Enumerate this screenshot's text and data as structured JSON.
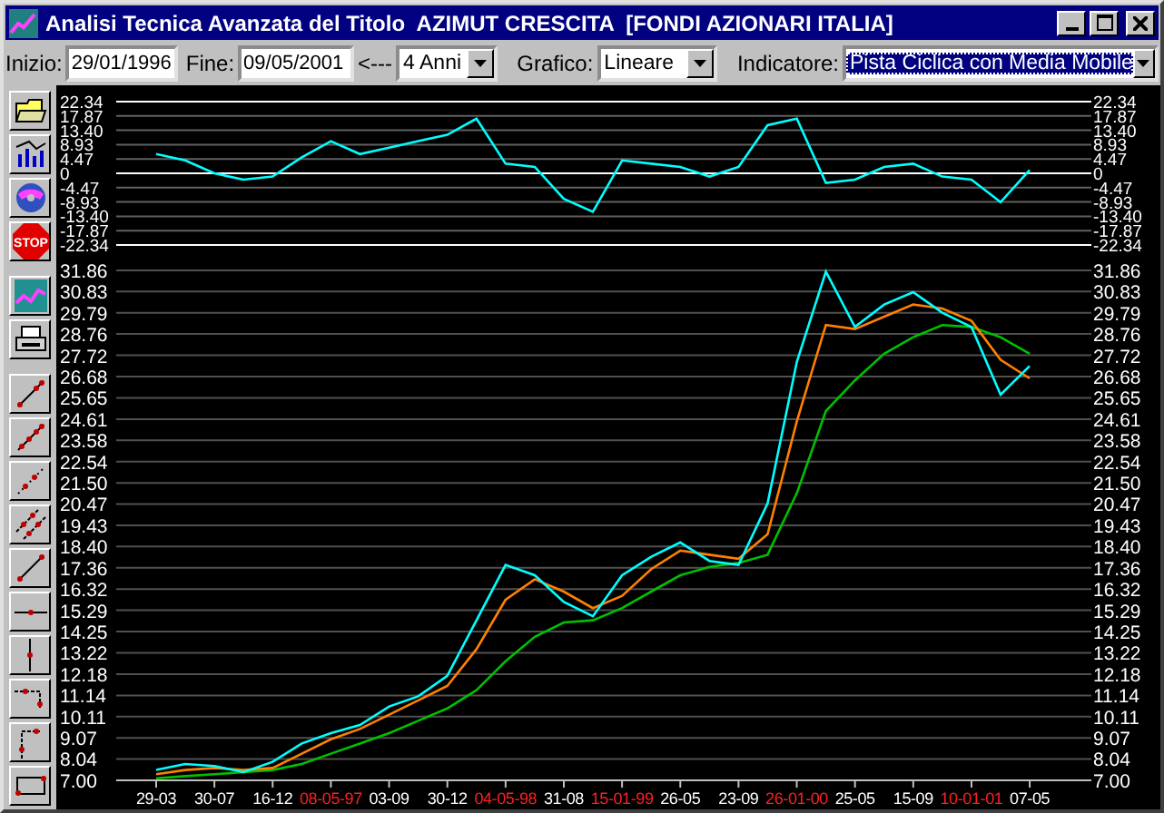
{
  "window": {
    "title": "Analisi Tecnica Avanzata del Titolo  AZIMUT CRESCITA  [FONDI AZIONARI ITALIA]"
  },
  "toolbar": {
    "start_label": "Inizio:",
    "start_value": "29/01/1996",
    "end_label": "Fine:",
    "end_value": "09/05/2001",
    "arrow": "<---",
    "period": "4 Anni",
    "chart_label": "Grafico:",
    "chart_type": "Lineare",
    "indicator_label": "Indicatore:",
    "indicator": "Pista Ciclica con Media Mobile"
  },
  "tools": [
    {
      "kind": "folder"
    },
    {
      "kind": "bars"
    },
    {
      "kind": "disc"
    },
    {
      "kind": "stop",
      "label": "STOP"
    },
    {
      "kind": "chart"
    },
    {
      "kind": "printer"
    },
    {
      "kind": "trend"
    },
    {
      "kind": "trend4"
    },
    {
      "kind": "dotted"
    },
    {
      "kind": "parallel"
    },
    {
      "kind": "line"
    },
    {
      "kind": "horizontal"
    },
    {
      "kind": "vertical"
    },
    {
      "kind": "hcorner"
    },
    {
      "kind": "vcorner"
    },
    {
      "kind": "rectangle"
    }
  ],
  "oscillator": {
    "right_labels": [
      "22.34",
      "17.87",
      "13.40",
      "8.93",
      "4.47",
      "0",
      "-4.47",
      "-8.93",
      "-13.40",
      "-17.87",
      "-22.34"
    ],
    "chart_data": {
      "type": "line",
      "grid": true,
      "ylim": [
        -22.34,
        22.34
      ],
      "yticks": [
        {
          "value": 22.34,
          "label": "22.34"
        },
        {
          "value": 17.87,
          "label": "17.87"
        },
        {
          "value": 13.4,
          "label": "13.40"
        },
        {
          "value": 8.93,
          "label": "8.93"
        },
        {
          "value": 4.47,
          "label": "4.47"
        },
        {
          "value": 0,
          "label": "0"
        },
        {
          "value": -4.47,
          "label": "-4.47"
        },
        {
          "value": -8.93,
          "label": "-8.93"
        },
        {
          "value": -13.4,
          "label": "-13.40"
        },
        {
          "value": -17.87,
          "label": "-17.87"
        },
        {
          "value": -22.34,
          "label": "-22.34"
        }
      ],
      "series": [
        {
          "color": "#00ffff",
          "values": [
            6,
            4,
            0,
            -2,
            -1,
            5,
            10,
            6,
            8,
            10,
            12,
            17,
            3,
            2,
            -8,
            -12,
            4,
            3,
            2,
            -1,
            2,
            15,
            17,
            -3,
            -2,
            2,
            3,
            -1,
            -2,
            -9,
            1
          ]
        }
      ]
    }
  },
  "price": {
    "right_labels": [
      "31.86",
      "30.83",
      "29.79",
      "28.76",
      "27.72",
      "26.68",
      "25.65",
      "24.61",
      "23.58",
      "22.54",
      "21.50",
      "20.47",
      "19.43",
      "18.40",
      "17.36",
      "16.32",
      "15.29",
      "14.25",
      "13.22",
      "12.18",
      "11.14",
      "10.11",
      "9.07",
      "8.04",
      "7.00"
    ],
    "xtick_highlighted": [
      false,
      false,
      false,
      true,
      false,
      false,
      true,
      false,
      true,
      false,
      false,
      true,
      false,
      false,
      true,
      false
    ],
    "chart_data": {
      "type": "line",
      "grid": true,
      "ylim": [
        7,
        31.86
      ],
      "categories": [
        "29-03",
        null,
        "30-07",
        null,
        "16-12",
        null,
        "08-05-97",
        null,
        "03-09",
        null,
        "30-12",
        null,
        "04-05-98",
        null,
        "31-08",
        null,
        "15-01-99",
        null,
        "26-05",
        null,
        "23-09",
        null,
        "26-01-00",
        null,
        "25-05",
        null,
        "15-09",
        null,
        "10-01-01",
        null,
        "07-05"
      ],
      "yticks": [
        {
          "value": 31.86,
          "label": "31.86"
        },
        {
          "value": 30.83,
          "label": "30.83"
        },
        {
          "value": 29.79,
          "label": "29.79"
        },
        {
          "value": 28.76,
          "label": "28.76"
        },
        {
          "value": 27.72,
          "label": "27.72"
        },
        {
          "value": 26.68,
          "label": "26.68"
        },
        {
          "value": 25.65,
          "label": "25.65"
        },
        {
          "value": 24.61,
          "label": "24.61"
        },
        {
          "value": 23.58,
          "label": "23.58"
        },
        {
          "value": 22.54,
          "label": "22.54"
        },
        {
          "value": 21.5,
          "label": "21.50"
        },
        {
          "value": 20.47,
          "label": "20.47"
        },
        {
          "value": 19.43,
          "label": "19.43"
        },
        {
          "value": 18.4,
          "label": "18.40"
        },
        {
          "value": 17.36,
          "label": "17.36"
        },
        {
          "value": 16.32,
          "label": "16.32"
        },
        {
          "value": 15.29,
          "label": "15.29"
        },
        {
          "value": 14.25,
          "label": "14.25"
        },
        {
          "value": 13.22,
          "label": "13.22"
        },
        {
          "value": 12.18,
          "label": "12.18"
        },
        {
          "value": 11.14,
          "label": "11.14"
        },
        {
          "value": 10.11,
          "label": "10.11"
        },
        {
          "value": 9.07,
          "label": "9.07"
        },
        {
          "value": 8.04,
          "label": "8.04"
        },
        {
          "value": 7,
          "label": "7.00"
        }
      ],
      "series": [
        {
          "color": "#00c000",
          "values": [
            7.1,
            7.2,
            7.3,
            7.4,
            7.5,
            7.8,
            8.3,
            8.8,
            9.3,
            9.9,
            10.5,
            11.4,
            12.8,
            14.0,
            14.7,
            14.8,
            15.4,
            16.2,
            17.0,
            17.4,
            17.6,
            18.0,
            21.0,
            25.0,
            26.5,
            27.8,
            28.6,
            29.2,
            29.1,
            28.6,
            27.8
          ]
        },
        {
          "color": "#ff8000",
          "values": [
            7.3,
            7.5,
            7.6,
            7.5,
            7.6,
            8.3,
            9.0,
            9.5,
            10.2,
            10.9,
            11.6,
            13.4,
            15.8,
            16.8,
            16.2,
            15.4,
            16.0,
            17.3,
            18.2,
            18.0,
            17.8,
            19.0,
            24.5,
            29.2,
            29.0,
            29.6,
            30.2,
            30.0,
            29.4,
            27.5,
            26.6
          ]
        },
        {
          "color": "#00ffff",
          "values": [
            7.5,
            7.8,
            7.7,
            7.4,
            7.9,
            8.8,
            9.3,
            9.7,
            10.6,
            11.1,
            12.1,
            14.8,
            17.5,
            17.0,
            15.7,
            15.0,
            17.0,
            17.9,
            18.6,
            17.7,
            17.5,
            20.5,
            27.4,
            31.8,
            29.1,
            30.2,
            30.8,
            29.8,
            29.1,
            25.8,
            27.2
          ]
        }
      ]
    }
  }
}
